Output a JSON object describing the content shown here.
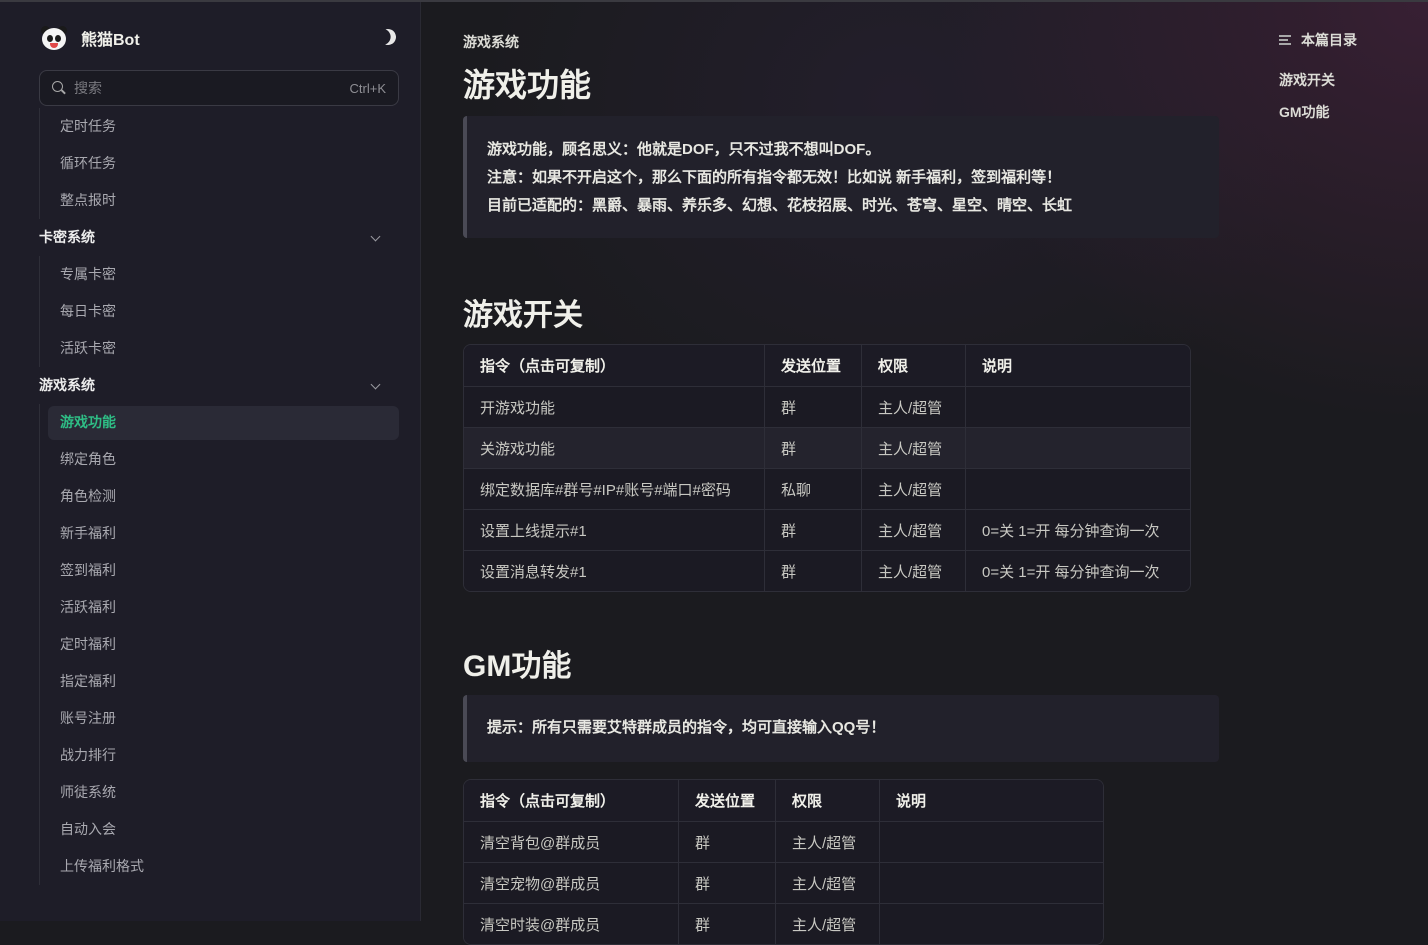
{
  "brand": {
    "name": "熊猫Bot"
  },
  "search": {
    "placeholder": "搜索",
    "shortcut": "Ctrl+K"
  },
  "sidebar": {
    "top_items": [
      "定时任务",
      "循环任务",
      "整点报时"
    ],
    "sections": [
      {
        "label": "卡密系统",
        "items": [
          "专属卡密",
          "每日卡密",
          "活跃卡密"
        ]
      },
      {
        "label": "游戏系统",
        "items": [
          "游戏功能",
          "绑定角色",
          "角色检测",
          "新手福利",
          "签到福利",
          "活跃福利",
          "定时福利",
          "指定福利",
          "账号注册",
          "战力排行",
          "师徒系统",
          "自动入会",
          "上传福利格式"
        ]
      }
    ],
    "active_item": "游戏功能"
  },
  "main": {
    "breadcrumb": "游戏系统",
    "title": "游戏功能",
    "intro": [
      "游戏功能，顾名思义：他就是DOF，只不过我不想叫DOF。",
      "注意：如果不开启这个，那么下面的所有指令都无效！比如说 新手福利，签到福利等！",
      "目前已适配的：黑爵、暴雨、养乐多、幻想、花枝招展、时光、苍穹、星空、晴空、长虹"
    ],
    "section1": {
      "heading": "游戏开关",
      "headers": [
        "指令（点击可复制）",
        "发送位置",
        "权限",
        "说明"
      ],
      "rows": [
        [
          "开游戏功能",
          "群",
          "主人/超管",
          ""
        ],
        [
          "关游戏功能",
          "群",
          "主人/超管",
          ""
        ],
        [
          "绑定数据库#群号#IP#账号#端口#密码",
          "私聊",
          "主人/超管",
          ""
        ],
        [
          "设置上线提示#1",
          "群",
          "主人/超管",
          "0=关 1=开 每分钟查询一次"
        ],
        [
          "设置消息转发#1",
          "群",
          "主人/超管",
          "0=关 1=开 每分钟查询一次"
        ]
      ]
    },
    "section2": {
      "heading": "GM功能",
      "tip": "提示：所有只需要艾特群成员的指令，均可直接输入QQ号！",
      "headers": [
        "指令（点击可复制）",
        "发送位置",
        "权限",
        "说明"
      ],
      "rows": [
        [
          "清空背包@群成员",
          "群",
          "主人/超管",
          ""
        ],
        [
          "清空宠物@群成员",
          "群",
          "主人/超管",
          ""
        ],
        [
          "清空时装@群成员",
          "群",
          "主人/超管",
          ""
        ]
      ]
    }
  },
  "toc": {
    "title": "本篇目录",
    "links": [
      "游戏开关",
      "GM功能"
    ]
  }
}
